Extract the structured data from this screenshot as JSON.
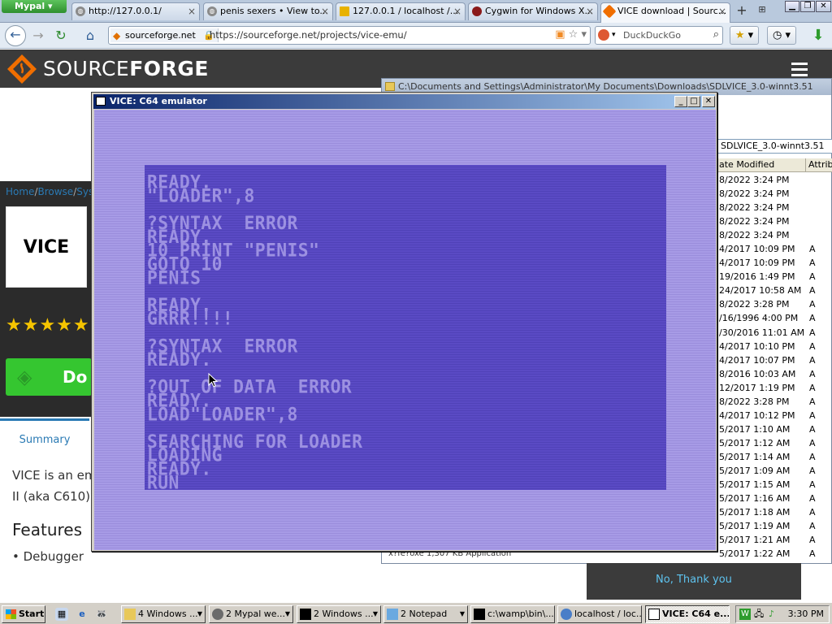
{
  "browser": {
    "app_menu": "Mypal",
    "tabs": [
      {
        "title": "http://127.0.0.1/"
      },
      {
        "title": "penis sexers • View to..."
      },
      {
        "title": "127.0.0.1 / localhost /..."
      },
      {
        "title": "Cygwin for Windows X..."
      },
      {
        "title": "VICE download | Sourc..."
      }
    ],
    "new_tab": "+",
    "site_identity": "sourceforge.net",
    "url": "https://sourceforge.net/projects/vice-emu/",
    "search_engine": "DuckDuckGo",
    "search_placeholder": "DuckDuckGo"
  },
  "sourceforge": {
    "logo_prefix": "SOURCE",
    "logo_suffix": "FORGE",
    "breadcrumb": [
      "Home",
      "/",
      "Browse",
      "/",
      "Sys"
    ],
    "project_logo_text": "VICE",
    "stars": "★★★★★",
    "download_label": "Do",
    "summary_tab": "Summary",
    "desc_line1": "VICE is an em",
    "desc_line2": "II (aka C610).",
    "features_heading": "Features",
    "feature_1": "Debugger",
    "no_thanks": "No, Thank you"
  },
  "explorer": {
    "title": "C:\\Documents and Settings\\Administrator\\My Documents\\Downloads\\SDLVICE_3.0-winnt3.51",
    "address": "SDLVICE_3.0-winnt3.51",
    "col_date": "ate Modified",
    "col_attr": "Attribu",
    "rows": [
      {
        "date": "8/2022 3:24 PM",
        "attr": ""
      },
      {
        "date": "8/2022 3:24 PM",
        "attr": ""
      },
      {
        "date": "8/2022 3:24 PM",
        "attr": ""
      },
      {
        "date": "8/2022 3:24 PM",
        "attr": ""
      },
      {
        "date": "8/2022 3:24 PM",
        "attr": ""
      },
      {
        "date": "4/2017 10:09 PM",
        "attr": "A"
      },
      {
        "date": "4/2017 10:09 PM",
        "attr": "A"
      },
      {
        "date": "19/2016 1:49 PM",
        "attr": "A"
      },
      {
        "date": "24/2017 10:58 AM",
        "attr": "A"
      },
      {
        "date": "8/2022 3:28 PM",
        "attr": "A"
      },
      {
        "date": "/16/1996 4:00 PM",
        "attr": "A"
      },
      {
        "date": "/30/2016 11:01 AM",
        "attr": "A"
      },
      {
        "date": "4/2017 10:10 PM",
        "attr": "A"
      },
      {
        "date": "4/2017 10:07 PM",
        "attr": "A"
      },
      {
        "date": "8/2016 10:03 AM",
        "attr": "A"
      },
      {
        "date": "12/2017 1:19 PM",
        "attr": "A"
      },
      {
        "date": "8/2022 3:28 PM",
        "attr": "A"
      },
      {
        "date": "4/2017 10:12 PM",
        "attr": "A"
      },
      {
        "date": "5/2017 1:10 AM",
        "attr": "A"
      },
      {
        "date": "5/2017 1:12 AM",
        "attr": "A"
      },
      {
        "date": "5/2017 1:14 AM",
        "attr": "A"
      },
      {
        "date": "5/2017 1:09 AM",
        "attr": "A"
      },
      {
        "date": "5/2017 1:15 AM",
        "attr": "A"
      },
      {
        "date": "5/2017 1:16 AM",
        "attr": "A"
      },
      {
        "date": "5/2017 1:18 AM",
        "attr": "A"
      },
      {
        "date": "5/2017 1:19 AM",
        "attr": "A"
      },
      {
        "date": "5/2017 1:21 AM",
        "attr": "A"
      },
      {
        "date": "5/2017 1:22 AM",
        "attr": "A"
      }
    ],
    "last_row_file": "x?fe?oxe      1,307 KB    Application"
  },
  "vice": {
    "title": "VICE: C64 emulator",
    "screen_lines": [
      "READY.",
      "\"LOADER\",8",
      "",
      "?SYNTAX  ERROR",
      "READY.",
      "10 PRINT \"PENIS\"",
      "GOTO 10",
      "PENIS",
      "",
      "READY.",
      "GRRR!!!!",
      "",
      "?SYNTAX  ERROR",
      "READY.",
      "",
      "?OUT OF DATA  ERROR",
      "READY.",
      "LOAD\"LOADER\",8",
      "",
      "SEARCHING FOR LOADER",
      "LOADING",
      "READY.",
      "RUN"
    ]
  },
  "taskbar": {
    "start": "Start",
    "tasks": [
      {
        "label": "4 Windows ..."
      },
      {
        "label": "2 Mypal we..."
      },
      {
        "label": "2 Windows ..."
      },
      {
        "label": "2 Notepad"
      },
      {
        "label": "c:\\wamp\\bin\\..."
      },
      {
        "label": "localhost / loc..."
      },
      {
        "label": "VICE: C64 e..."
      }
    ],
    "clock": "3:30 PM"
  }
}
